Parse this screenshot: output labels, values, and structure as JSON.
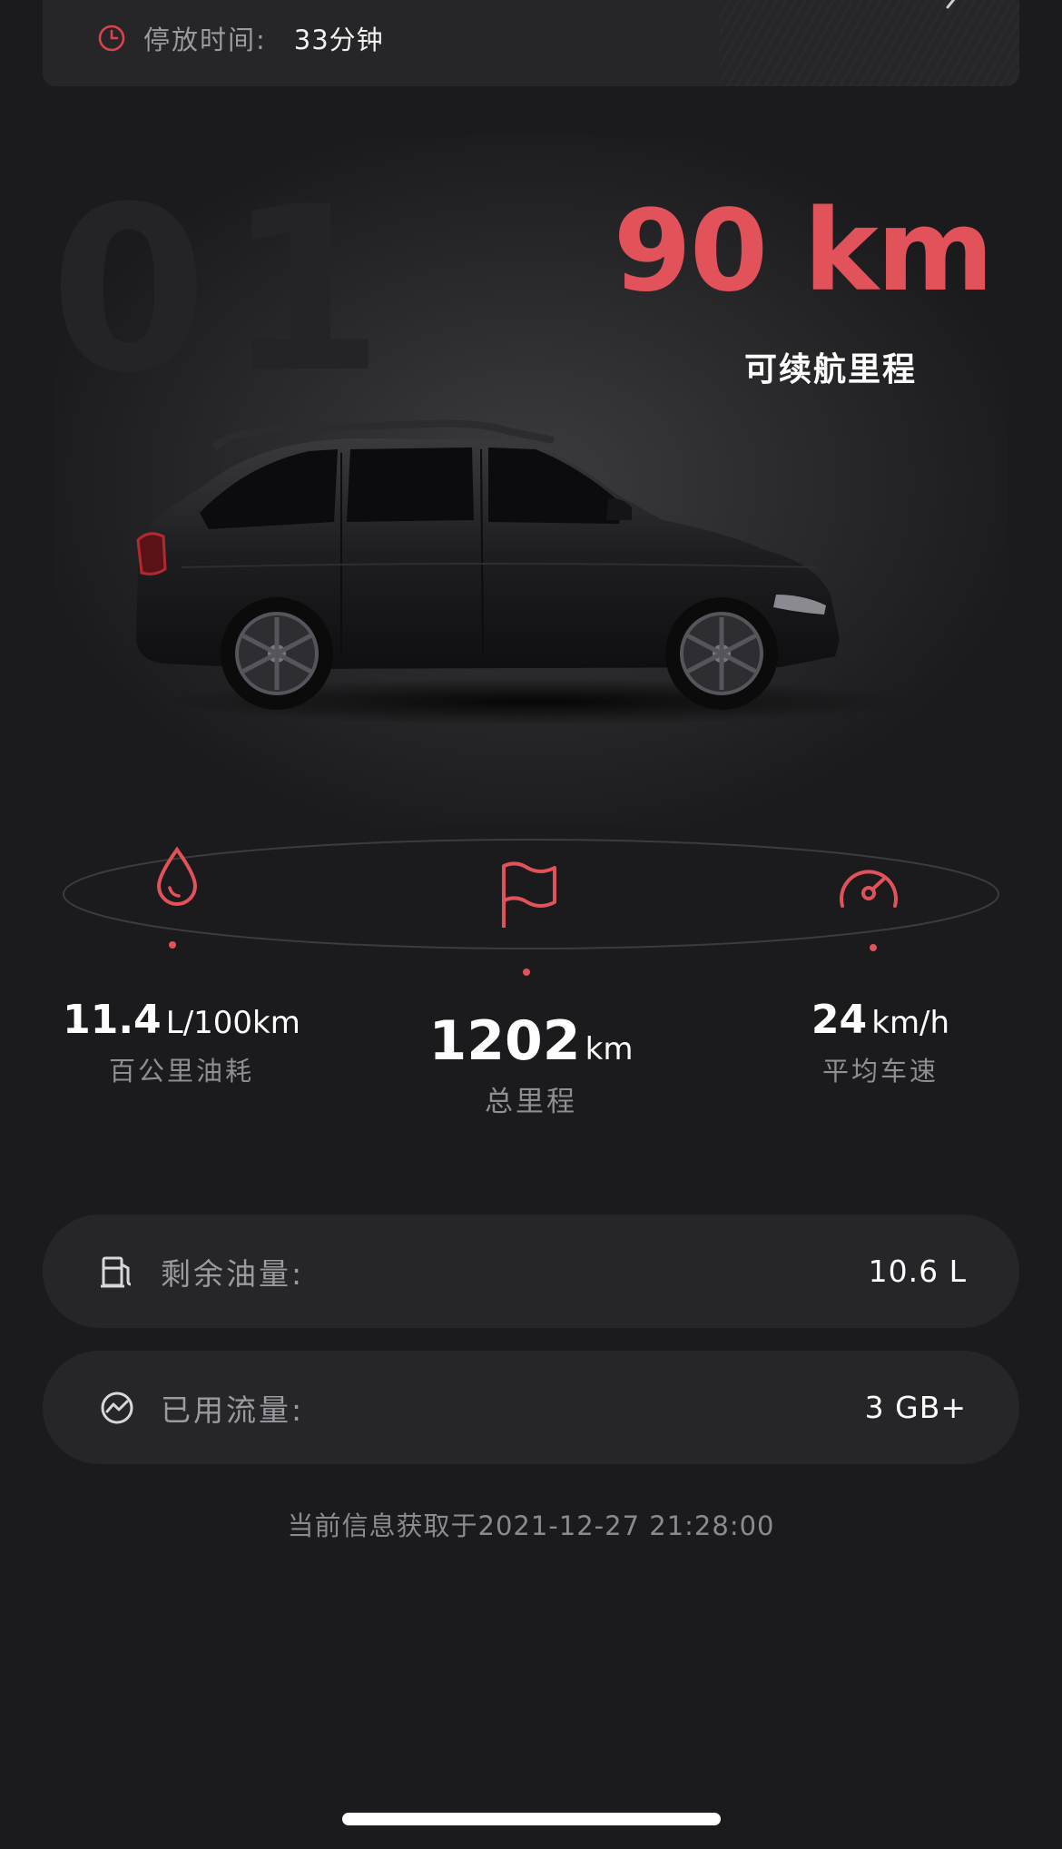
{
  "parking": {
    "label": "停放时间:",
    "value": "33分钟"
  },
  "vehicle": {
    "model_watermark": "01",
    "range_value": "90 km",
    "range_label": "可续航里程"
  },
  "stats": {
    "fuel_consumption": {
      "value": "11.4",
      "unit": "L/100km",
      "label": "百公里油耗",
      "icon": "droplet-icon"
    },
    "total_mileage": {
      "value": "1202",
      "unit": "km",
      "label": "总里程",
      "icon": "flag-icon"
    },
    "avg_speed": {
      "value": "24",
      "unit": "km/h",
      "label": "平均车速",
      "icon": "speedometer-icon"
    }
  },
  "info": {
    "fuel_remaining": {
      "label": "剩余油量:",
      "value": "10.6 L",
      "icon": "fuel-pump-icon"
    },
    "data_used": {
      "label": "已用流量:",
      "value": "3 GB+",
      "icon": "data-usage-icon"
    }
  },
  "timestamp": "当前信息获取于2021-12-27 21:28:00",
  "colors": {
    "accent": "#e2525a",
    "background": "#1b1b1d",
    "card": "#262628",
    "muted_text": "#9a9aa0"
  }
}
